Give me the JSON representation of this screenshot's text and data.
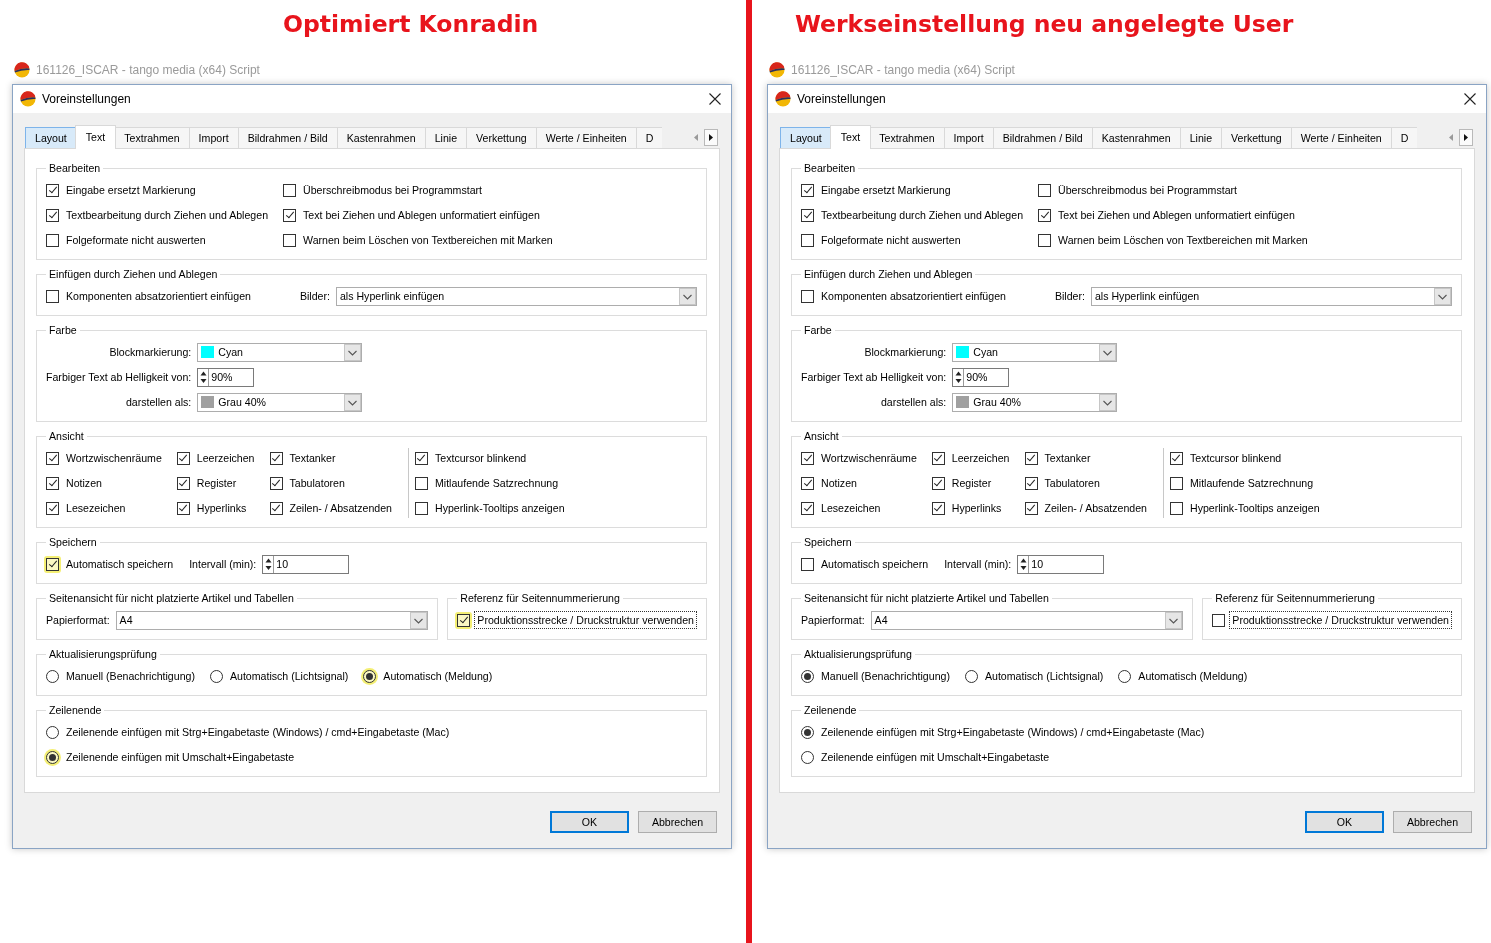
{
  "panels": [
    {
      "heading": "Optimiert Konradin",
      "background_window": {
        "title": "161126_ISCAR - tango media (x64) Script"
      },
      "dialog": {
        "title": "Voreinstellungen",
        "tabs": [
          {
            "label": "Layout",
            "selected": false,
            "hovered": true
          },
          {
            "label": "Text",
            "selected": true,
            "hovered": false
          },
          {
            "label": "Textrahmen",
            "selected": false,
            "hovered": false
          },
          {
            "label": "Import",
            "selected": false,
            "hovered": false
          },
          {
            "label": "Bildrahmen / Bild",
            "selected": false,
            "hovered": false
          },
          {
            "label": "Kastenrahmen",
            "selected": false,
            "hovered": false
          },
          {
            "label": "Linie",
            "selected": false,
            "hovered": false
          },
          {
            "label": "Verkettung",
            "selected": false,
            "hovered": false
          },
          {
            "label": "Werte / Einheiten",
            "selected": false,
            "hovered": false
          },
          {
            "label": "D",
            "selected": false,
            "hovered": false
          }
        ],
        "tab_scroll_buttons": [
          {
            "kind": "back",
            "disabled": true
          },
          {
            "kind": "forward",
            "disabled": false
          }
        ],
        "groups": [
          {
            "kind": "checkbox_columns",
            "title": "Bearbeiten",
            "columns": [
              {
                "divider": false,
                "items": [
                  {
                    "label": "Eingabe ersetzt Markierung",
                    "checked": true,
                    "highlighted": false
                  },
                  {
                    "label": "Textbearbeitung durch Ziehen und Ablegen",
                    "checked": true,
                    "highlighted": false
                  },
                  {
                    "label": "Folgeformate nicht auswerten",
                    "checked": false,
                    "highlighted": false
                  }
                ]
              },
              {
                "divider": false,
                "items": [
                  {
                    "label": "Überschreibmodus bei Programmstart",
                    "checked": false,
                    "highlighted": false
                  },
                  {
                    "label": "Text bei Ziehen und Ablegen unformatiert einfügen",
                    "checked": true,
                    "highlighted": false
                  },
                  {
                    "label": "Warnen beim Löschen von Textbereichen mit Marken",
                    "checked": false,
                    "highlighted": false
                  }
                ]
              }
            ]
          },
          {
            "kind": "inline",
            "title": "Einfügen durch Ziehen und Ablegen",
            "controls": [
              {
                "kind": "checkbox",
                "label": "Komponenten absatzorientiert einfügen",
                "checked": false,
                "highlighted": false
              },
              {
                "kind": "dropdown",
                "label": "Bilder:",
                "value": "als Hyperlink einfügen"
              }
            ]
          },
          {
            "kind": "form",
            "title": "Farbe",
            "controls": [
              {
                "kind": "color_dropdown",
                "label": "Blockmarkierung:",
                "value": "Cyan",
                "color": "#00ffff"
              },
              {
                "kind": "spinner",
                "label": "Farbiger Text ab Helligkeit von:",
                "value": "90%"
              },
              {
                "kind": "color_dropdown",
                "label": "darstellen als:",
                "value": "Grau 40%",
                "color": "#a0a0a0"
              }
            ]
          },
          {
            "kind": "checkbox_columns",
            "title": "Ansicht",
            "columns": [
              {
                "divider": false,
                "items": [
                  {
                    "label": "Wortzwischenräume",
                    "checked": true,
                    "highlighted": false
                  },
                  {
                    "label": "Notizen",
                    "checked": true,
                    "highlighted": false
                  },
                  {
                    "label": "Lesezeichen",
                    "checked": true,
                    "highlighted": false
                  }
                ]
              },
              {
                "divider": false,
                "items": [
                  {
                    "label": "Leerzeichen",
                    "checked": true,
                    "highlighted": false
                  },
                  {
                    "label": "Register",
                    "checked": true,
                    "highlighted": false
                  },
                  {
                    "label": "Hyperlinks",
                    "checked": true,
                    "highlighted": false
                  }
                ]
              },
              {
                "divider": false,
                "items": [
                  {
                    "label": "Textanker",
                    "checked": true,
                    "highlighted": false
                  },
                  {
                    "label": "Tabulatoren",
                    "checked": true,
                    "highlighted": false
                  },
                  {
                    "label": "Zeilen- / Absatzenden",
                    "checked": true,
                    "highlighted": false
                  }
                ]
              },
              {
                "divider": true,
                "items": [
                  {
                    "label": "Textcursor blinkend",
                    "checked": true,
                    "highlighted": false
                  },
                  {
                    "label": "Mitlaufende Satzrechnung",
                    "checked": false,
                    "highlighted": false
                  },
                  {
                    "label": "Hyperlink-Tooltips anzeigen",
                    "checked": false,
                    "highlighted": false
                  }
                ]
              }
            ]
          },
          {
            "kind": "inline",
            "title": "Speichern",
            "controls": [
              {
                "kind": "checkbox",
                "label": "Automatisch speichern",
                "checked": true,
                "highlighted": true
              },
              {
                "kind": "spinner",
                "label": "Intervall (min):",
                "value": "10"
              }
            ]
          },
          {
            "kind": "split",
            "groups": [
              {
                "kind": "inline",
                "title": "Seitenansicht für nicht platzierte Artikel und Tabellen",
                "controls": [
                  {
                    "kind": "dropdown",
                    "label": "Papierformat:",
                    "value": "A4"
                  }
                ]
              },
              {
                "kind": "inline",
                "title": "Referenz für Seitennummerierung",
                "controls": [
                  {
                    "kind": "checkbox",
                    "label": "Produktionsstrecke / Druckstruktur verwenden",
                    "checked": true,
                    "highlighted": true,
                    "focused": true
                  }
                ]
              }
            ]
          },
          {
            "kind": "radio_row",
            "title": "Aktualisierungsprüfung",
            "options": [
              {
                "label": "Manuell (Benachrichtigung)",
                "selected": false,
                "highlighted": false
              },
              {
                "label": "Automatisch (Lichtsignal)",
                "selected": false,
                "highlighted": false
              },
              {
                "label": "Automatisch (Meldung)",
                "selected": true,
                "highlighted": true
              }
            ]
          },
          {
            "kind": "radio_list",
            "title": "Zeilenende",
            "options": [
              {
                "label": "Zeilenende einfügen mit Strg+Eingabetaste (Windows) / cmd+Eingabetaste (Mac)",
                "selected": false,
                "highlighted": false
              },
              {
                "label": "Zeilenende einfügen mit Umschalt+Eingabetaste",
                "selected": true,
                "highlighted": true
              }
            ]
          }
        ],
        "buttons": [
          {
            "label": "OK",
            "default": true
          },
          {
            "label": "Abbrechen",
            "default": false
          }
        ]
      }
    },
    {
      "heading": "Werkseinstellung neu angelegte User",
      "background_window": {
        "title": "161126_ISCAR - tango media (x64) Script"
      },
      "dialog": {
        "title": "Voreinstellungen",
        "tabs": [
          {
            "label": "Layout",
            "selected": false,
            "hovered": true
          },
          {
            "label": "Text",
            "selected": true,
            "hovered": false
          },
          {
            "label": "Textrahmen",
            "selected": false,
            "hovered": false
          },
          {
            "label": "Import",
            "selected": false,
            "hovered": false
          },
          {
            "label": "Bildrahmen / Bild",
            "selected": false,
            "hovered": false
          },
          {
            "label": "Kastenrahmen",
            "selected": false,
            "hovered": false
          },
          {
            "label": "Linie",
            "selected": false,
            "hovered": false
          },
          {
            "label": "Verkettung",
            "selected": false,
            "hovered": false
          },
          {
            "label": "Werte / Einheiten",
            "selected": false,
            "hovered": false
          },
          {
            "label": "D",
            "selected": false,
            "hovered": false
          }
        ],
        "tab_scroll_buttons": [
          {
            "kind": "back",
            "disabled": true
          },
          {
            "kind": "forward",
            "disabled": false
          }
        ],
        "groups": [
          {
            "kind": "checkbox_columns",
            "title": "Bearbeiten",
            "columns": [
              {
                "divider": false,
                "items": [
                  {
                    "label": "Eingabe ersetzt Markierung",
                    "checked": true,
                    "highlighted": false
                  },
                  {
                    "label": "Textbearbeitung durch Ziehen und Ablegen",
                    "checked": true,
                    "highlighted": false
                  },
                  {
                    "label": "Folgeformate nicht auswerten",
                    "checked": false,
                    "highlighted": false
                  }
                ]
              },
              {
                "divider": false,
                "items": [
                  {
                    "label": "Überschreibmodus bei Programmstart",
                    "checked": false,
                    "highlighted": false
                  },
                  {
                    "label": "Text bei Ziehen und Ablegen unformatiert einfügen",
                    "checked": true,
                    "highlighted": false
                  },
                  {
                    "label": "Warnen beim Löschen von Textbereichen mit Marken",
                    "checked": false,
                    "highlighted": false
                  }
                ]
              }
            ]
          },
          {
            "kind": "inline",
            "title": "Einfügen durch Ziehen und Ablegen",
            "controls": [
              {
                "kind": "checkbox",
                "label": "Komponenten absatzorientiert einfügen",
                "checked": false,
                "highlighted": false
              },
              {
                "kind": "dropdown",
                "label": "Bilder:",
                "value": "als Hyperlink einfügen"
              }
            ]
          },
          {
            "kind": "form",
            "title": "Farbe",
            "controls": [
              {
                "kind": "color_dropdown",
                "label": "Blockmarkierung:",
                "value": "Cyan",
                "color": "#00ffff"
              },
              {
                "kind": "spinner",
                "label": "Farbiger Text ab Helligkeit von:",
                "value": "90%"
              },
              {
                "kind": "color_dropdown",
                "label": "darstellen als:",
                "value": "Grau 40%",
                "color": "#a0a0a0"
              }
            ]
          },
          {
            "kind": "checkbox_columns",
            "title": "Ansicht",
            "columns": [
              {
                "divider": false,
                "items": [
                  {
                    "label": "Wortzwischenräume",
                    "checked": true,
                    "highlighted": false
                  },
                  {
                    "label": "Notizen",
                    "checked": true,
                    "highlighted": false
                  },
                  {
                    "label": "Lesezeichen",
                    "checked": true,
                    "highlighted": false
                  }
                ]
              },
              {
                "divider": false,
                "items": [
                  {
                    "label": "Leerzeichen",
                    "checked": true,
                    "highlighted": false
                  },
                  {
                    "label": "Register",
                    "checked": true,
                    "highlighted": false
                  },
                  {
                    "label": "Hyperlinks",
                    "checked": true,
                    "highlighted": false
                  }
                ]
              },
              {
                "divider": false,
                "items": [
                  {
                    "label": "Textanker",
                    "checked": true,
                    "highlighted": false
                  },
                  {
                    "label": "Tabulatoren",
                    "checked": true,
                    "highlighted": false
                  },
                  {
                    "label": "Zeilen- / Absatzenden",
                    "checked": true,
                    "highlighted": false
                  }
                ]
              },
              {
                "divider": true,
                "items": [
                  {
                    "label": "Textcursor blinkend",
                    "checked": true,
                    "highlighted": false
                  },
                  {
                    "label": "Mitlaufende Satzrechnung",
                    "checked": false,
                    "highlighted": false
                  },
                  {
                    "label": "Hyperlink-Tooltips anzeigen",
                    "checked": false,
                    "highlighted": false
                  }
                ]
              }
            ]
          },
          {
            "kind": "inline",
            "title": "Speichern",
            "controls": [
              {
                "kind": "checkbox",
                "label": "Automatisch speichern",
                "checked": false,
                "highlighted": false
              },
              {
                "kind": "spinner",
                "label": "Intervall (min):",
                "value": "10"
              }
            ]
          },
          {
            "kind": "split",
            "groups": [
              {
                "kind": "inline",
                "title": "Seitenansicht für nicht platzierte Artikel und Tabellen",
                "controls": [
                  {
                    "kind": "dropdown",
                    "label": "Papierformat:",
                    "value": "A4"
                  }
                ]
              },
              {
                "kind": "inline",
                "title": "Referenz für Seitennummerierung",
                "controls": [
                  {
                    "kind": "checkbox",
                    "label": "Produktionsstrecke / Druckstruktur verwenden",
                    "checked": false,
                    "highlighted": false,
                    "focused": true
                  }
                ]
              }
            ]
          },
          {
            "kind": "radio_row",
            "title": "Aktualisierungsprüfung",
            "options": [
              {
                "label": "Manuell (Benachrichtigung)",
                "selected": true,
                "highlighted": false
              },
              {
                "label": "Automatisch (Lichtsignal)",
                "selected": false,
                "highlighted": false
              },
              {
                "label": "Automatisch (Meldung)",
                "selected": false,
                "highlighted": false
              }
            ]
          },
          {
            "kind": "radio_list",
            "title": "Zeilenende",
            "options": [
              {
                "label": "Zeilenende einfügen mit Strg+Eingabetaste (Windows) / cmd+Eingabetaste (Mac)",
                "selected": true,
                "highlighted": false
              },
              {
                "label": "Zeilenende einfügen mit Umschalt+Eingabetaste",
                "selected": false,
                "highlighted": false
              }
            ]
          }
        ],
        "buttons": [
          {
            "label": "OK",
            "default": true
          },
          {
            "label": "Abbrechen",
            "default": false
          }
        ]
      }
    }
  ]
}
